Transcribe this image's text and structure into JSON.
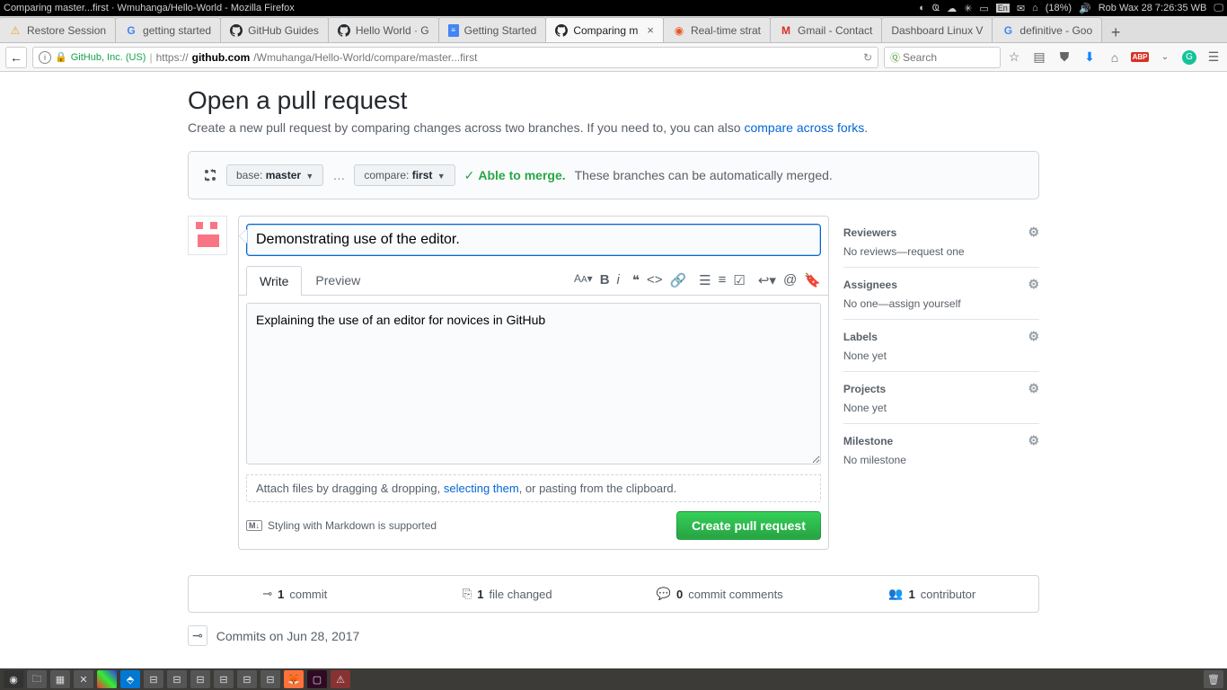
{
  "os": {
    "window_title": "Comparing master...first · Wmuhanga/Hello-World - Mozilla Firefox",
    "battery": "(18%)",
    "clock": "Rob Wax 28  7:26:35 WB"
  },
  "tabs": [
    {
      "label": "Restore Session"
    },
    {
      "label": "getting started"
    },
    {
      "label": "GitHub Guides"
    },
    {
      "label": "Hello World · G"
    },
    {
      "label": "Getting Started"
    },
    {
      "label": "Comparing m",
      "active": true
    },
    {
      "label": "Real-time strat"
    },
    {
      "label": "Gmail - Contact"
    },
    {
      "label": "Dashboard Linux V"
    },
    {
      "label": "definitive - Goo"
    }
  ],
  "url": {
    "site_label": "GitHub, Inc. (US)",
    "prefix": "https://",
    "domain": "github.com",
    "path": "/Wmuhanga/Hello-World/compare/master...first",
    "search_placeholder": "Search"
  },
  "page": {
    "heading": "Open a pull request",
    "subtitle_pre": "Create a new pull request by comparing changes across two branches. If you need to, you can also ",
    "subtitle_link": "compare across forks",
    "base_label": "base:",
    "base_branch": "master",
    "compare_label": "compare:",
    "compare_branch": "first",
    "merge_status": "Able to merge.",
    "merge_detail": "These branches can be automatically merged.",
    "title_value": "Demonstrating use of the editor.",
    "write_tab": "Write",
    "preview_tab": "Preview",
    "body_value": "Explaining the use of an editor for novices in GitHub",
    "attach_pre": "Attach files by dragging & dropping, ",
    "attach_link": "selecting them",
    "attach_post": ", or pasting from the clipboard.",
    "md_hint": "Styling with Markdown is supported",
    "create_btn": "Create pull request"
  },
  "sidebar": {
    "reviewers": {
      "title": "Reviewers",
      "value": "No reviews—request one"
    },
    "assignees": {
      "title": "Assignees",
      "value": "No one—assign yourself"
    },
    "labels": {
      "title": "Labels",
      "value": "None yet"
    },
    "projects": {
      "title": "Projects",
      "value": "None yet"
    },
    "milestone": {
      "title": "Milestone",
      "value": "No milestone"
    }
  },
  "diffstat": {
    "commits_n": "1",
    "commits_t": "commit",
    "files_n": "1",
    "files_t": "file changed",
    "comments_n": "0",
    "comments_t": "commit comments",
    "contrib_n": "1",
    "contrib_t": "contributor"
  },
  "commits_date": "Commits on Jun 28, 2017"
}
